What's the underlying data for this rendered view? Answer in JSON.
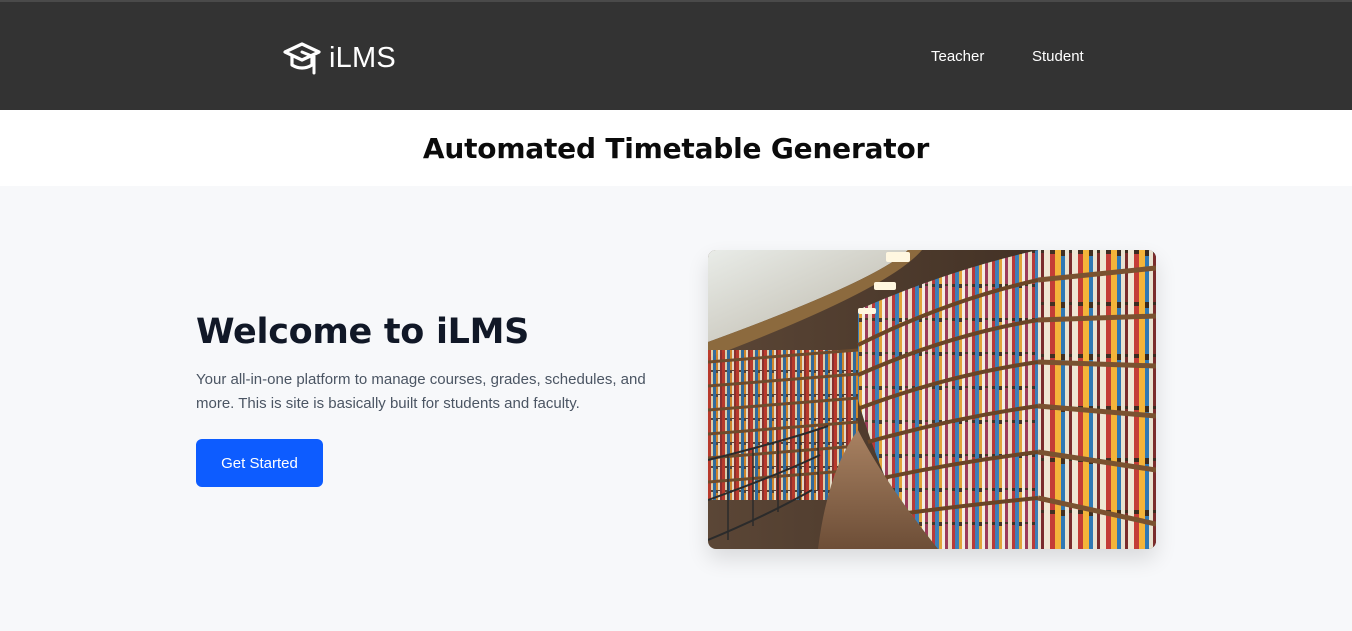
{
  "header": {
    "brand_name": "iLMS",
    "brand_icon": "graduation-cap-icon",
    "nav": {
      "teacher_label": "Teacher",
      "student_label": "Student"
    }
  },
  "page_title": "Automated Timetable Generator",
  "hero": {
    "heading": "Welcome to iLMS",
    "description": "Your all-in-one platform to manage courses, grades, schedules, and more. This is site is basically built for students and faculty.",
    "cta_label": "Get Started",
    "image_subject": "library-bookshelves-image"
  },
  "colors": {
    "header_bg": "#333333",
    "accent": "#0d5cff",
    "hero_bg": "#f7f8fa"
  }
}
